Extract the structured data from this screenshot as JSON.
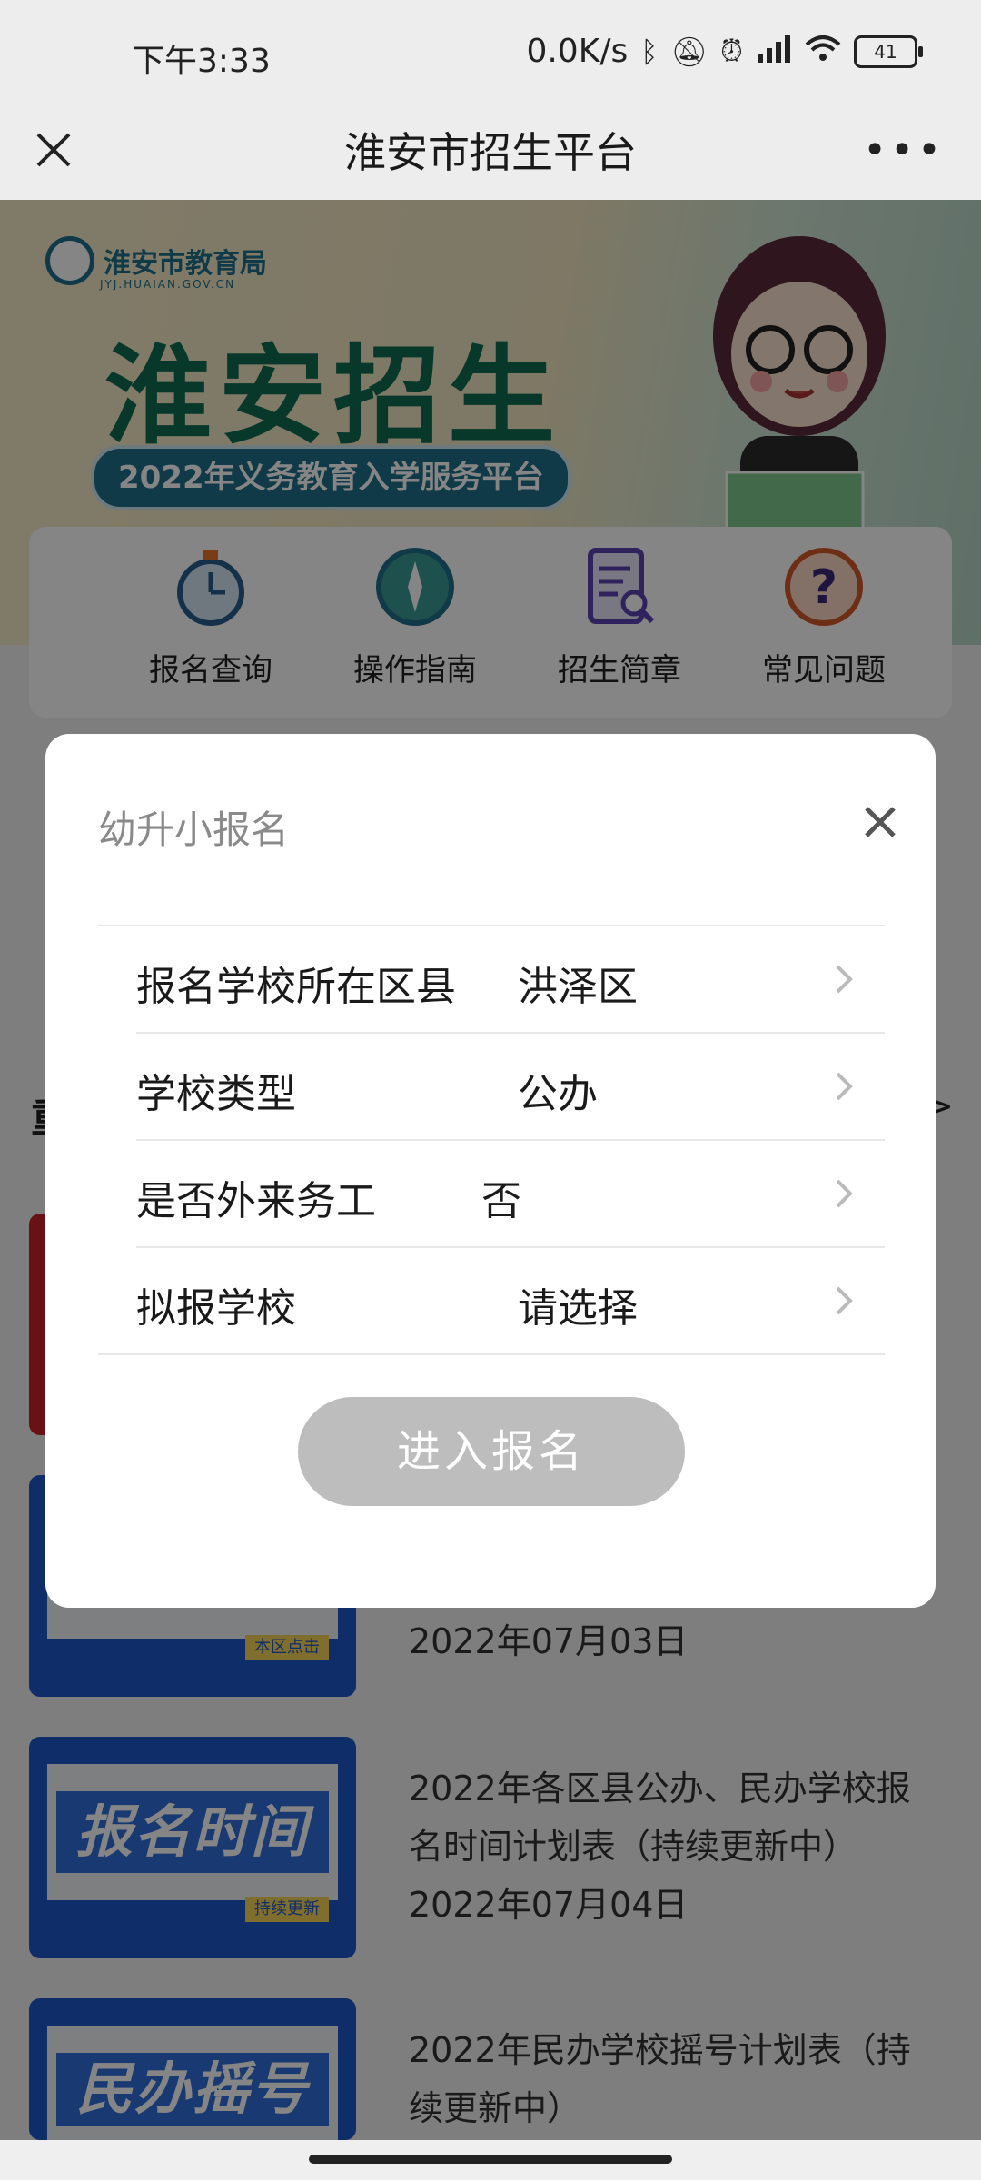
{
  "status_bar": {
    "time": "下午3:33",
    "net_speed": "0.0K/s",
    "battery": "41"
  },
  "nav": {
    "title": "淮安市招生平台"
  },
  "banner": {
    "logo_text": "淮安市教育局",
    "logo_sub": "JYJ.HUAIAN.GOV.CN",
    "title": "淮安招生",
    "subtitle": "2022年义务教育入学服务平台"
  },
  "quick_nav": [
    {
      "label": "报名查询",
      "icon": "stopwatch-icon"
    },
    {
      "label": "操作指南",
      "icon": "compass-icon"
    },
    {
      "label": "招生简章",
      "icon": "document-search-icon"
    },
    {
      "label": "常见问题",
      "icon": "question-icon"
    }
  ],
  "list": {
    "section_title": "重",
    "section_more": ">",
    "items": [
      {
        "thumb_text": "",
        "thumb_tag": "",
        "text": ""
      },
      {
        "thumb_text": "",
        "thumb_tag": "本区点击",
        "text": "2022年07月03日"
      },
      {
        "thumb_text": "报名时间",
        "thumb_tag": "持续更新",
        "text_line1": "2022年各区县公办、民办学校报",
        "text_line2": "名时间计划表（持续更新中）",
        "date": "2022年07月04日"
      },
      {
        "thumb_text": "民办摇号",
        "thumb_tag": "",
        "text_line1": "2022年民办学校摇号计划表（持",
        "text_line2": "续更新中）"
      }
    ]
  },
  "modal": {
    "title": "幼升小报名",
    "rows": [
      {
        "label": "报名学校所在区县",
        "value": "洪泽区"
      },
      {
        "label": "学校类型",
        "value": "公办"
      },
      {
        "label": "是否外来务工",
        "value": "否"
      },
      {
        "label": "拟报学校",
        "value": "请选择"
      }
    ],
    "submit_label": "进入报名"
  },
  "colors": {
    "accent_green": "#0f6b52",
    "disabled_button": "#bdbdbd",
    "thumb_blue": "#1e56c7",
    "thumb_red": "#c9242b"
  }
}
